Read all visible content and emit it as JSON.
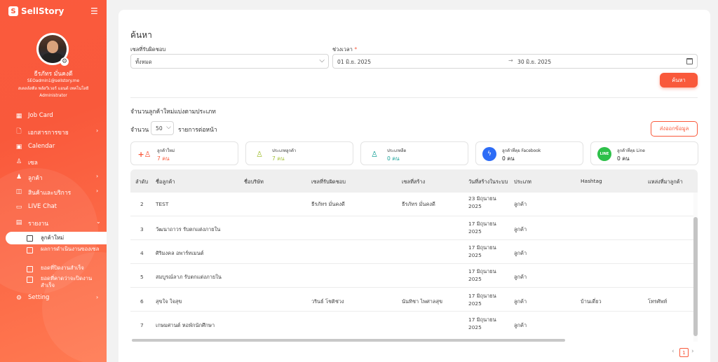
{
  "app": {
    "brand": "SellStory"
  },
  "user": {
    "name": "ธีรภัทร มั่นคงดี",
    "email": "SEOadmin1@sellstory.me",
    "company": "สเตลล์สตีล พลัสวิเวอร์ แอนด์ เทคโนโลยี",
    "role": "Administrator"
  },
  "nav": {
    "items": [
      {
        "label": "Job Card",
        "icon": "job-card-icon"
      },
      {
        "label": "เอกสารการขาย",
        "icon": "document-icon",
        "chevron": "›"
      },
      {
        "label": "Calendar",
        "icon": "calendar-icon"
      },
      {
        "label": "เซล",
        "icon": "person-icon"
      },
      {
        "label": "ลูกค้า",
        "icon": "customers-icon",
        "chevron": "›"
      },
      {
        "label": "สินค้าและบริการ",
        "icon": "box-icon",
        "chevron": "›"
      },
      {
        "label": "LIVE Chat",
        "icon": "chat-icon"
      },
      {
        "label": "รายงาน",
        "icon": "report-icon",
        "chevron": "⌄"
      },
      {
        "label": "Setting",
        "icon": "gear-icon",
        "chevron": "›"
      }
    ],
    "sub_items": [
      {
        "label": "ลูกค้าใหม่",
        "active": true
      },
      {
        "label": "ผลการดำเนินงานของเซล"
      },
      {
        "label": "ยอดที่ปิดงานสำเร็จ"
      },
      {
        "label": "ยอดที่คาดว่าจะปิดงานสำเร็จ"
      }
    ]
  },
  "search": {
    "title": "ค้นหา",
    "sales_label": "เซลที่รับผิดชอบ",
    "sales_value": "ทั้งหมด",
    "period_label": "ช่วงเวลา",
    "period_required": "*",
    "date_from": "01 มิ.ย. 2025",
    "date_to": "30 มิ.ย. 2025",
    "date_arrow": "→",
    "button": "ค้นหา"
  },
  "report": {
    "section_title": "จำนวนลูกค้าใหม่แบ่งตามประเภท",
    "per_page_label": "จำนวน",
    "per_page_value": "50",
    "per_page_suffix": "รายการต่อหน้า",
    "export_button": "ส่งออกข้อมูล"
  },
  "stats": [
    {
      "title": "ลูกค้าใหม่",
      "value": "7 คน",
      "color": "#f9593b",
      "icon": "add-user-icon"
    },
    {
      "title": "ประเภทลูกค้า",
      "value": "7 คน",
      "color": "#a5c23a",
      "icon": "user-icon"
    },
    {
      "title": "ประเภทลีด",
      "value": "0 คน",
      "color": "#1aa39a",
      "icon": "lead-icon"
    },
    {
      "title": "ลูกค้าที่คุย Facebook",
      "value": "0 คน",
      "color": "#2d6cf6",
      "icon": "messenger-icon"
    },
    {
      "title": "ลูกค้าที่คุย Line",
      "value": "0 คน",
      "color": "#2ec04a",
      "icon": "line-icon"
    }
  ],
  "table": {
    "headers": [
      "ลำดับ",
      "ชื่อลูกค้า",
      "ชื่อบริษัท",
      "เซลที่รับผิดชอบ",
      "เซลที่สร้าง",
      "วันที่สร้างในระบบ",
      "ประเภท",
      "Hashtag",
      "แหล่งที่มาลูกค้า"
    ],
    "rows": [
      {
        "no": "2",
        "name": "TEST",
        "company": "",
        "sales": "ธีรภัทร มั่นคงดี",
        "creator": "ธีรภัทร มั่นคงดี",
        "date1": "23 มิถุนายน",
        "date2": "2025",
        "type": "ลูกค้า",
        "hashtag": "",
        "source": ""
      },
      {
        "no": "3",
        "name": "วัฒนาถาวร รับตกแต่งภายใน",
        "company": "",
        "sales": "",
        "creator": "",
        "date1": "17 มิถุนายน",
        "date2": "2025",
        "type": "ลูกค้า",
        "hashtag": "",
        "source": ""
      },
      {
        "no": "4",
        "name": "ศิริมงคล อพาร์ทเมนต์",
        "company": "",
        "sales": "",
        "creator": "",
        "date1": "17 มิถุนายน",
        "date2": "2025",
        "type": "ลูกค้า",
        "hashtag": "",
        "source": ""
      },
      {
        "no": "5",
        "name": "สมบูรณ์ลาภ รับตกแต่งภายใน",
        "company": "",
        "sales": "",
        "creator": "",
        "date1": "17 มิถุนายน",
        "date2": "2025",
        "type": "ลูกค้า",
        "hashtag": "",
        "source": ""
      },
      {
        "no": "6",
        "name": "สุขใจ ใจสุข",
        "company": "",
        "sales": "วรินธ์ โชติช่วง",
        "creator": "นันทิชา ไพศาลสุข",
        "date1": "17 มิถุนายน",
        "date2": "2025",
        "type": "ลูกค้า",
        "hashtag": "บ้านเดี่ยว",
        "source": "โทรศัพท์"
      },
      {
        "no": "7",
        "name": "เกษมศานต์ หอพักนักศึกษา",
        "company": "",
        "sales": "",
        "creator": "",
        "date1": "17 มิถุนายน",
        "date2": "2025",
        "type": "ลูกค้า",
        "hashtag": "",
        "source": ""
      }
    ]
  },
  "pagination": {
    "prev": "‹",
    "current": "1",
    "next": "›"
  },
  "colors": {
    "accent": "#f9593b"
  }
}
